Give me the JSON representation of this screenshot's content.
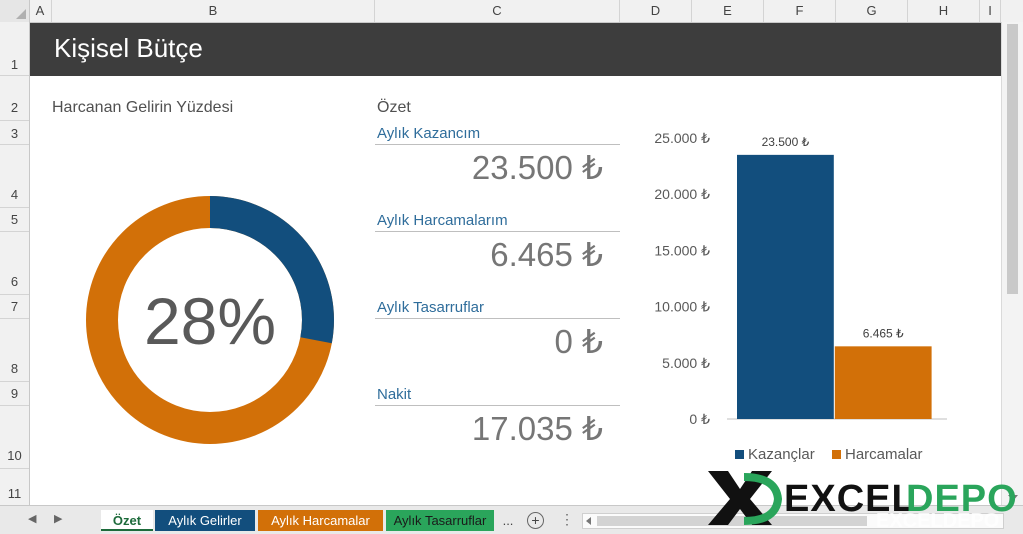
{
  "columns": [
    "A",
    "B",
    "C",
    "D",
    "E",
    "F",
    "G",
    "H",
    "I"
  ],
  "rows": [
    "1",
    "2",
    "3",
    "4",
    "5",
    "6",
    "7",
    "8",
    "9",
    "10",
    "11"
  ],
  "title": "Kişisel Bütçe",
  "donut": {
    "label": "Harcanan Gelirin Yüzdesi",
    "percent_text": "28%",
    "fraction": 0.28,
    "colors": {
      "spent": "#124e7d",
      "remaining": "#d27008"
    }
  },
  "summary": {
    "heading": "Özet",
    "items": [
      {
        "label": "Aylık Kazancım",
        "value": "23.500 ₺"
      },
      {
        "label": "Aylık Harcamalarım",
        "value": "6.465 ₺"
      },
      {
        "label": "Aylık Tasarruflar",
        "value": "0 ₺"
      },
      {
        "label": "Nakit",
        "value": "17.035 ₺"
      }
    ]
  },
  "chart_data": {
    "type": "bar",
    "categories": [
      "Kazançlar",
      "Harcamalar"
    ],
    "values": [
      23500,
      6465
    ],
    "value_labels": [
      "23.500 ₺",
      "6.465 ₺"
    ],
    "colors": [
      "#124e7d",
      "#d27008"
    ],
    "ylim": [
      0,
      25000
    ],
    "yticks": [
      0,
      5000,
      10000,
      15000,
      20000,
      25000
    ],
    "ytick_labels": [
      "0 ₺",
      "5.000 ₺",
      "10.000 ₺",
      "15.000 ₺",
      "20.000 ₺",
      "25.000 ₺"
    ],
    "legend": [
      "Kazançlar",
      "Harcamalar"
    ],
    "legend_position": "bottom",
    "grid": false
  },
  "tabs": [
    {
      "label": "Özet",
      "bg": "#ffffff",
      "fg": "#1d6b3b",
      "active": true
    },
    {
      "label": "Aylık Gelirler",
      "bg": "#124e7d",
      "fg": "#ffffff"
    },
    {
      "label": "Aylık Harcamalar",
      "bg": "#d27008",
      "fg": "#ffffff"
    },
    {
      "label": "Aylık Tasarruflar",
      "bg": "#2aa55b",
      "fg": "#1a1a1a"
    }
  ],
  "tab_more": "...",
  "watermark": "EXCELDEPO"
}
